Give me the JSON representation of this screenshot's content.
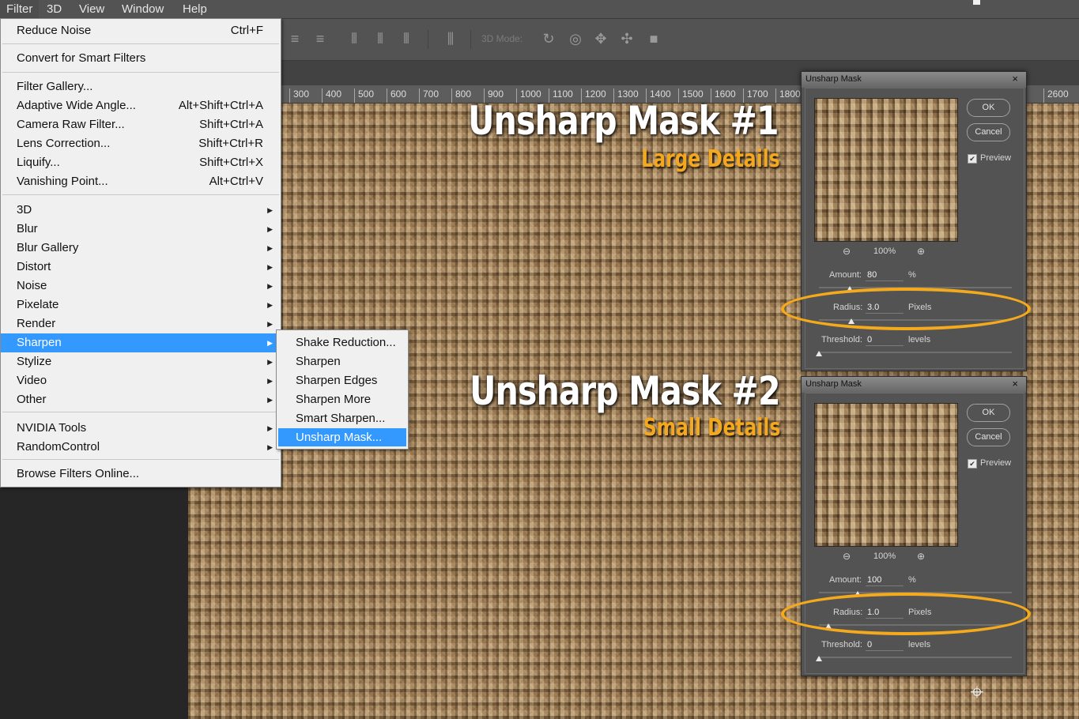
{
  "menubar": {
    "items": [
      {
        "label": "Filter",
        "active": true
      },
      {
        "label": "3D"
      },
      {
        "label": "View"
      },
      {
        "label": "Window"
      },
      {
        "label": "Help"
      }
    ]
  },
  "options_bar": {
    "mode_3d_label": "3D Mode:"
  },
  "ruler": {
    "ticks": [
      "300",
      "400",
      "500",
      "600",
      "700",
      "800",
      "900",
      "1000",
      "1100",
      "1200",
      "1300",
      "1400",
      "1500",
      "1600",
      "1700",
      "1800",
      "2600"
    ]
  },
  "filter_menu": {
    "items": [
      {
        "label": "Reduce Noise",
        "shortcut": "Ctrl+F"
      },
      {
        "label": "Convert for Smart Filters"
      },
      {
        "label": "Filter Gallery..."
      },
      {
        "label": "Adaptive Wide Angle...",
        "shortcut": "Alt+Shift+Ctrl+A"
      },
      {
        "label": "Camera Raw Filter...",
        "shortcut": "Shift+Ctrl+A"
      },
      {
        "label": "Lens Correction...",
        "shortcut": "Shift+Ctrl+R"
      },
      {
        "label": "Liquify...",
        "shortcut": "Shift+Ctrl+X"
      },
      {
        "label": "Vanishing Point...",
        "shortcut": "Alt+Ctrl+V"
      },
      {
        "label": "3D",
        "submenu": true
      },
      {
        "label": "Blur",
        "submenu": true
      },
      {
        "label": "Blur Gallery",
        "submenu": true
      },
      {
        "label": "Distort",
        "submenu": true
      },
      {
        "label": "Noise",
        "submenu": true
      },
      {
        "label": "Pixelate",
        "submenu": true
      },
      {
        "label": "Render",
        "submenu": true
      },
      {
        "label": "Sharpen",
        "submenu": true,
        "highlighted": true
      },
      {
        "label": "Stylize",
        "submenu": true
      },
      {
        "label": "Video",
        "submenu": true
      },
      {
        "label": "Other",
        "submenu": true
      },
      {
        "label": "NVIDIA Tools",
        "submenu": true
      },
      {
        "label": "RandomControl",
        "submenu": true
      },
      {
        "label": "Browse Filters Online..."
      }
    ]
  },
  "sharpen_submenu": {
    "items": [
      {
        "label": "Shake Reduction..."
      },
      {
        "label": "Sharpen"
      },
      {
        "label": "Sharpen Edges"
      },
      {
        "label": "Sharpen More"
      },
      {
        "label": "Smart Sharpen..."
      },
      {
        "label": "Unsharp Mask...",
        "highlighted": true
      }
    ]
  },
  "annotations": [
    {
      "title": "Unsharp Mask #1",
      "subtitle": "Large Details"
    },
    {
      "title": "Unsharp Mask #2",
      "subtitle": "Small Details"
    }
  ],
  "dialogs": [
    {
      "title": "Unsharp Mask",
      "close": "×",
      "ok": "OK",
      "cancel": "Cancel",
      "preview_label": "Preview",
      "preview_checked": true,
      "zoom": "100%",
      "amount_label": "Amount:",
      "amount": "80",
      "amount_unit": "%",
      "amount_fraction": 0.16,
      "radius_label": "Radius:",
      "radius": "3.0",
      "radius_unit": "Pixels",
      "radius_fraction": 0.17,
      "threshold_label": "Threshold:",
      "threshold": "0",
      "threshold_unit": "levels",
      "threshold_fraction": 0.0
    },
    {
      "title": "Unsharp Mask",
      "close": "×",
      "ok": "OK",
      "cancel": "Cancel",
      "preview_label": "Preview",
      "preview_checked": true,
      "zoom": "100%",
      "amount_label": "Amount:",
      "amount": "100",
      "amount_unit": "%",
      "amount_fraction": 0.2,
      "radius_label": "Radius:",
      "radius": "1.0",
      "radius_unit": "Pixels",
      "radius_fraction": 0.05,
      "threshold_label": "Threshold:",
      "threshold": "0",
      "threshold_unit": "levels",
      "threshold_fraction": 0.0
    }
  ],
  "colors": {
    "highlight": "#3399ff",
    "annotation_orange": "#f4a81e"
  }
}
